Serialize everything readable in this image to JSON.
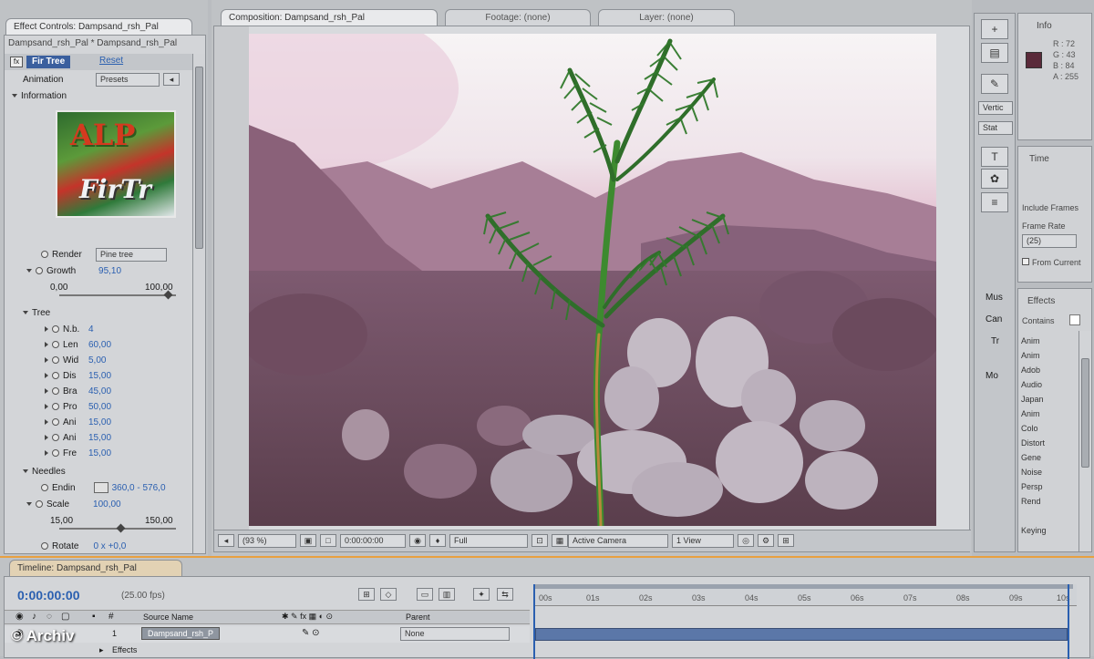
{
  "effect_panel": {
    "tab1": "Effect Controls: Dampsand_rsh_Pal",
    "breadcrumb": "Dampsand_rsh_Pal * Dampsand_rsh_Pal",
    "effect_name": "Fir Tree",
    "reset_label": "Reset",
    "animation_label": "Animation",
    "animation_value": "Presets",
    "information_label": "Information",
    "thumb_text_1": "ALP",
    "thumb_text_2": "FirTr",
    "render_label": "Render",
    "render_value": "Pine tree",
    "growth_label": "Growth",
    "growth_value": "95,10",
    "slider_min": "0,00",
    "slider_max": "100,00",
    "tree_label": "Tree",
    "tree_rows": [
      {
        "label": "N.b.",
        "value": "4"
      },
      {
        "label": "Len",
        "value": "60,00"
      },
      {
        "label": "Wid",
        "value": "5,00"
      },
      {
        "label": "Dis",
        "value": "15,00"
      },
      {
        "label": "Bra",
        "value": "45,00"
      },
      {
        "label": "Pro",
        "value": "50,00"
      },
      {
        "label": "Ani",
        "value": "15,00"
      },
      {
        "label": "Ani",
        "value": "15,00"
      },
      {
        "label": "Fre",
        "value": "15,00"
      }
    ],
    "needles_label": "Needles",
    "end_label": "Endin",
    "end_value": "360,0 - 576,0",
    "scale_label": "Scale",
    "scale_value": "100,00",
    "scale_min": "15,00",
    "scale_max": "150,00",
    "rotate_label": "Rotate",
    "rotate_value": "0 x +0,0"
  },
  "comp_panel": {
    "tab_comp": "Composition: Dampsand_rsh_Pal",
    "tab_footage": "Footage: (none)",
    "tab_layer": "Layer: (none)",
    "zoom": "(93 %)",
    "timecode": "0:00:00:00",
    "resolution": "Full",
    "camera": "Active Camera",
    "views": "1 View"
  },
  "info_panel": {
    "tab": "Info",
    "r": "R : 72",
    "g": "G : 43",
    "b": "B : 84",
    "a": "A : 255",
    "swatch_color": "#5a2a3a"
  },
  "tools_panel": {
    "btn1": "Vertic",
    "btn2": "Stat",
    "icons": [
      "T",
      "✿",
      "≡"
    ]
  },
  "time_panel": {
    "tab": "Time",
    "frames_label": "Include Frames",
    "frame_rate_label": "Frame Rate",
    "frame_rate_value": "(25)",
    "from_current": "From Current"
  },
  "effects_panel": {
    "tab": "Effects",
    "contains_label": "Contains",
    "items": [
      "Anim",
      "Anim",
      "Adob",
      "Audio",
      "Japan",
      "Anim",
      "Colo",
      "Distort",
      "Gene",
      "Noise",
      "Persp",
      "Rend",
      "Keying"
    ]
  },
  "mid_panel": {
    "labels": [
      "Mus",
      "Can",
      "Tr",
      "Mo"
    ]
  },
  "timeline": {
    "tab": "Timeline: Dampsand_rsh_Pal",
    "timecode": "0:00:00:00",
    "fps": "(25.00 fps)",
    "col_source": "Source Name",
    "col_parent": "Parent",
    "layer_num": "1",
    "layer_name": "Dampsand_rsh_P",
    "parent_value": "None",
    "effects_label": "Effects",
    "ticks": [
      "00s",
      "01s",
      "02s",
      "03s",
      "04s",
      "05s",
      "06s",
      "07s",
      "08s",
      "09s",
      "10s"
    ]
  },
  "watermark": "© Archiv"
}
